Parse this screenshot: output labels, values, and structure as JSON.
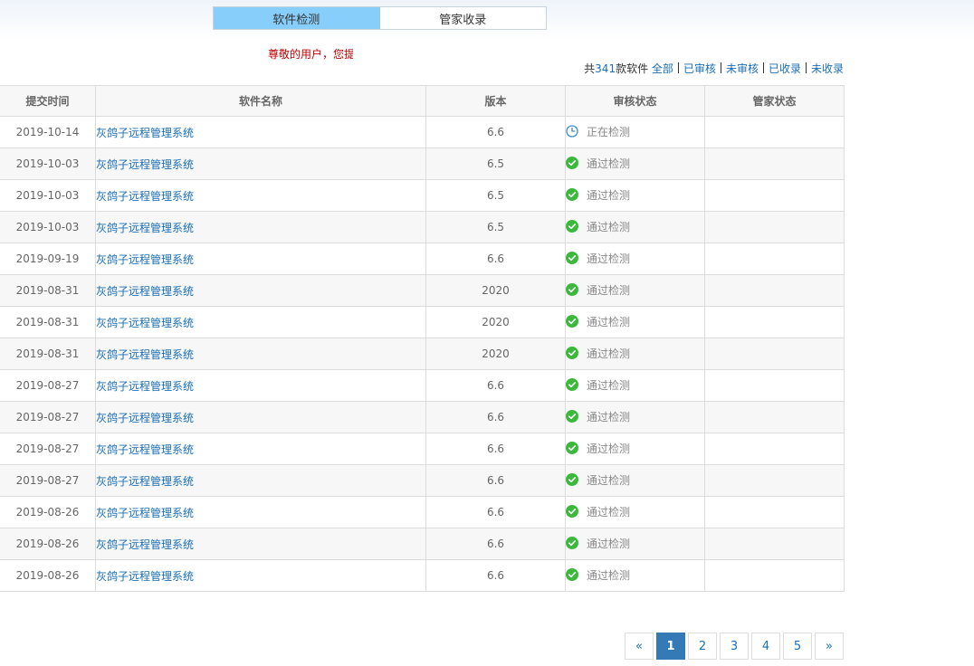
{
  "tabs": [
    {
      "label": "软件检测",
      "active": true
    },
    {
      "label": "管家收录",
      "active": false
    }
  ],
  "notice": "尊敬的用户，您提",
  "filter": {
    "prefix": "共",
    "count": "341",
    "suffix": "款软件",
    "links": [
      "全部",
      "已审核",
      "未审核",
      "已收录",
      "未收录"
    ]
  },
  "table": {
    "headers": [
      "提交时间",
      "软件名称",
      "版本",
      "审核状态",
      "管家状态"
    ],
    "rows": [
      {
        "date": "2019-10-14",
        "name": "灰鸽子远程管理系统",
        "version": "6.6",
        "status": "正在检测",
        "status_icon": "clock-icon",
        "manager": ""
      },
      {
        "date": "2019-10-03",
        "name": "灰鸽子远程管理系统",
        "version": "6.5",
        "status": "通过检测",
        "status_icon": "check-circle-icon",
        "manager": ""
      },
      {
        "date": "2019-10-03",
        "name": "灰鸽子远程管理系统",
        "version": "6.5",
        "status": "通过检测",
        "status_icon": "check-circle-icon",
        "manager": ""
      },
      {
        "date": "2019-10-03",
        "name": "灰鸽子远程管理系统",
        "version": "6.5",
        "status": "通过检测",
        "status_icon": "check-circle-icon",
        "manager": ""
      },
      {
        "date": "2019-09-19",
        "name": "灰鸽子远程管理系统",
        "version": "6.6",
        "status": "通过检测",
        "status_icon": "check-circle-icon",
        "manager": ""
      },
      {
        "date": "2019-08-31",
        "name": "灰鸽子远程管理系统",
        "version": "2020",
        "status": "通过检测",
        "status_icon": "check-circle-icon",
        "manager": ""
      },
      {
        "date": "2019-08-31",
        "name": "灰鸽子远程管理系统",
        "version": "2020",
        "status": "通过检测",
        "status_icon": "check-circle-icon",
        "manager": ""
      },
      {
        "date": "2019-08-31",
        "name": "灰鸽子远程管理系统",
        "version": "2020",
        "status": "通过检测",
        "status_icon": "check-circle-icon",
        "manager": ""
      },
      {
        "date": "2019-08-27",
        "name": "灰鸽子远程管理系统",
        "version": "6.6",
        "status": "通过检测",
        "status_icon": "check-circle-icon",
        "manager": ""
      },
      {
        "date": "2019-08-27",
        "name": "灰鸽子远程管理系统",
        "version": "6.6",
        "status": "通过检测",
        "status_icon": "check-circle-icon",
        "manager": ""
      },
      {
        "date": "2019-08-27",
        "name": "灰鸽子远程管理系统",
        "version": "6.6",
        "status": "通过检测",
        "status_icon": "check-circle-icon",
        "manager": ""
      },
      {
        "date": "2019-08-27",
        "name": "灰鸽子远程管理系统",
        "version": "6.6",
        "status": "通过检测",
        "status_icon": "check-circle-icon",
        "manager": ""
      },
      {
        "date": "2019-08-26",
        "name": "灰鸽子远程管理系统",
        "version": "6.6",
        "status": "通过检测",
        "status_icon": "check-circle-icon",
        "manager": ""
      },
      {
        "date": "2019-08-26",
        "name": "灰鸽子远程管理系统",
        "version": "6.6",
        "status": "通过检测",
        "status_icon": "check-circle-icon",
        "manager": ""
      },
      {
        "date": "2019-08-26",
        "name": "灰鸽子远程管理系统",
        "version": "6.6",
        "status": "通过检测",
        "status_icon": "check-circle-icon",
        "manager": ""
      }
    ]
  },
  "pagination": {
    "prev": "«",
    "pages": [
      "1",
      "2",
      "3",
      "4",
      "5"
    ],
    "current": "1",
    "next": "»"
  },
  "colors": {
    "tab_active": "#87cefa",
    "link": "#1a6eb5",
    "notice": "#c00000",
    "ok": "#3cb83c",
    "clock": "#3c8dc8",
    "pager_active": "#337ab7"
  }
}
